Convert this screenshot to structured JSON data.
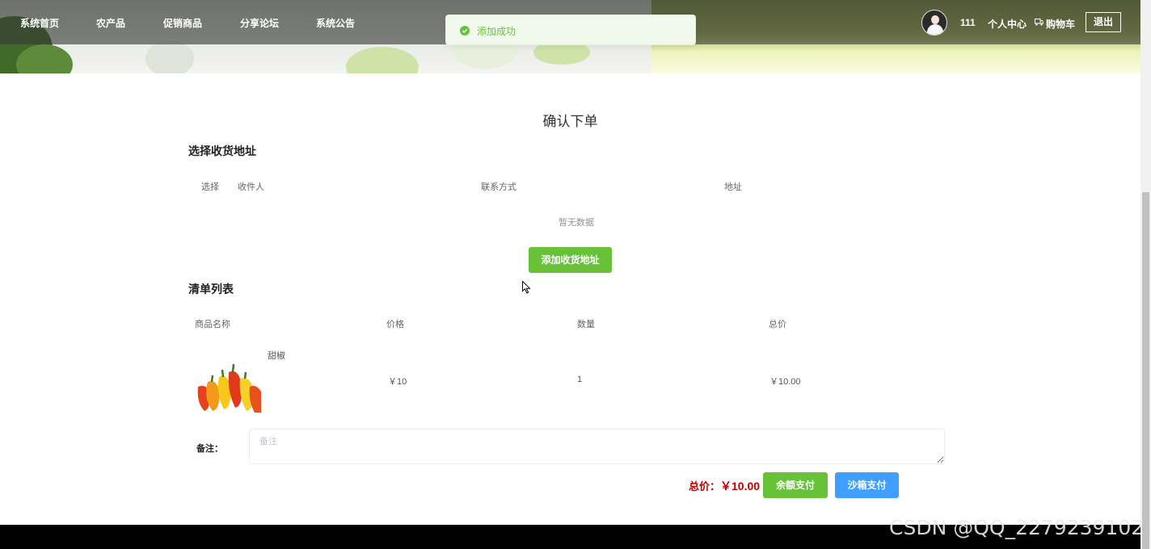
{
  "nav": {
    "items": [
      "系统首页",
      "农产品",
      "促销商品",
      "分享论坛",
      "系统公告"
    ]
  },
  "toast": {
    "text": "添加成功",
    "icon": "check-circle-icon"
  },
  "user": {
    "name": "111",
    "center": "个人中心",
    "cart": "购物车",
    "cart_icon": "cart-icon",
    "logout": "退出"
  },
  "page": {
    "title": "确认下单"
  },
  "address": {
    "heading": "选择收货地址",
    "columns": [
      "选择",
      "收件人",
      "联系方式",
      "地址"
    ],
    "empty": "暂无数据",
    "add_button": "添加收货地址"
  },
  "list": {
    "heading": "清单列表",
    "columns": [
      "商品名称",
      "价格",
      "数量",
      "总价"
    ],
    "rows": [
      {
        "name": "甜椒",
        "price": "￥10",
        "quantity": "1",
        "total": "￥10.00"
      }
    ]
  },
  "remark": {
    "label": "备注：",
    "placeholder": "备注"
  },
  "summary": {
    "total_label": "总价：",
    "total_value": "￥10.00",
    "balance_pay": "余额支付",
    "sandbox_pay": "沙箱支付"
  },
  "watermark": "CSDN @QQ_2279239102",
  "colors": {
    "success_green": "#67c23a",
    "primary_blue": "#409eff",
    "price_red": "#c00000",
    "footer_black": "#000000"
  }
}
